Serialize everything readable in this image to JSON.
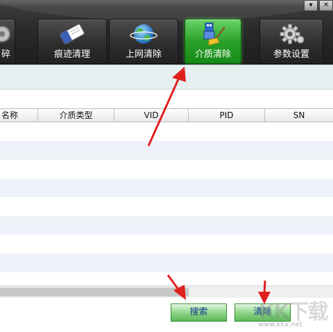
{
  "window_controls": {
    "menu": "▾",
    "close": "✕"
  },
  "toolbar": {
    "tabs": [
      {
        "id": "shred",
        "label": "碎"
      },
      {
        "id": "trace",
        "label": "痕迹清理"
      },
      {
        "id": "internet",
        "label": "上网清除"
      },
      {
        "id": "media",
        "label": "介质清除",
        "active": true
      },
      {
        "id": "settings",
        "label": "参数设置"
      }
    ]
  },
  "table": {
    "columns": [
      "名称",
      "介质类型",
      "VID",
      "PID",
      "SN"
    ],
    "rows": []
  },
  "buttons": {
    "search": "搜索",
    "clear": "清除"
  },
  "watermark": {
    "logo": "KK下载",
    "url": "www.kkx.net"
  },
  "colors": {
    "active_tab": "#2aa12a",
    "button_text": "#0f3d8a",
    "arrow": "#e02020"
  }
}
